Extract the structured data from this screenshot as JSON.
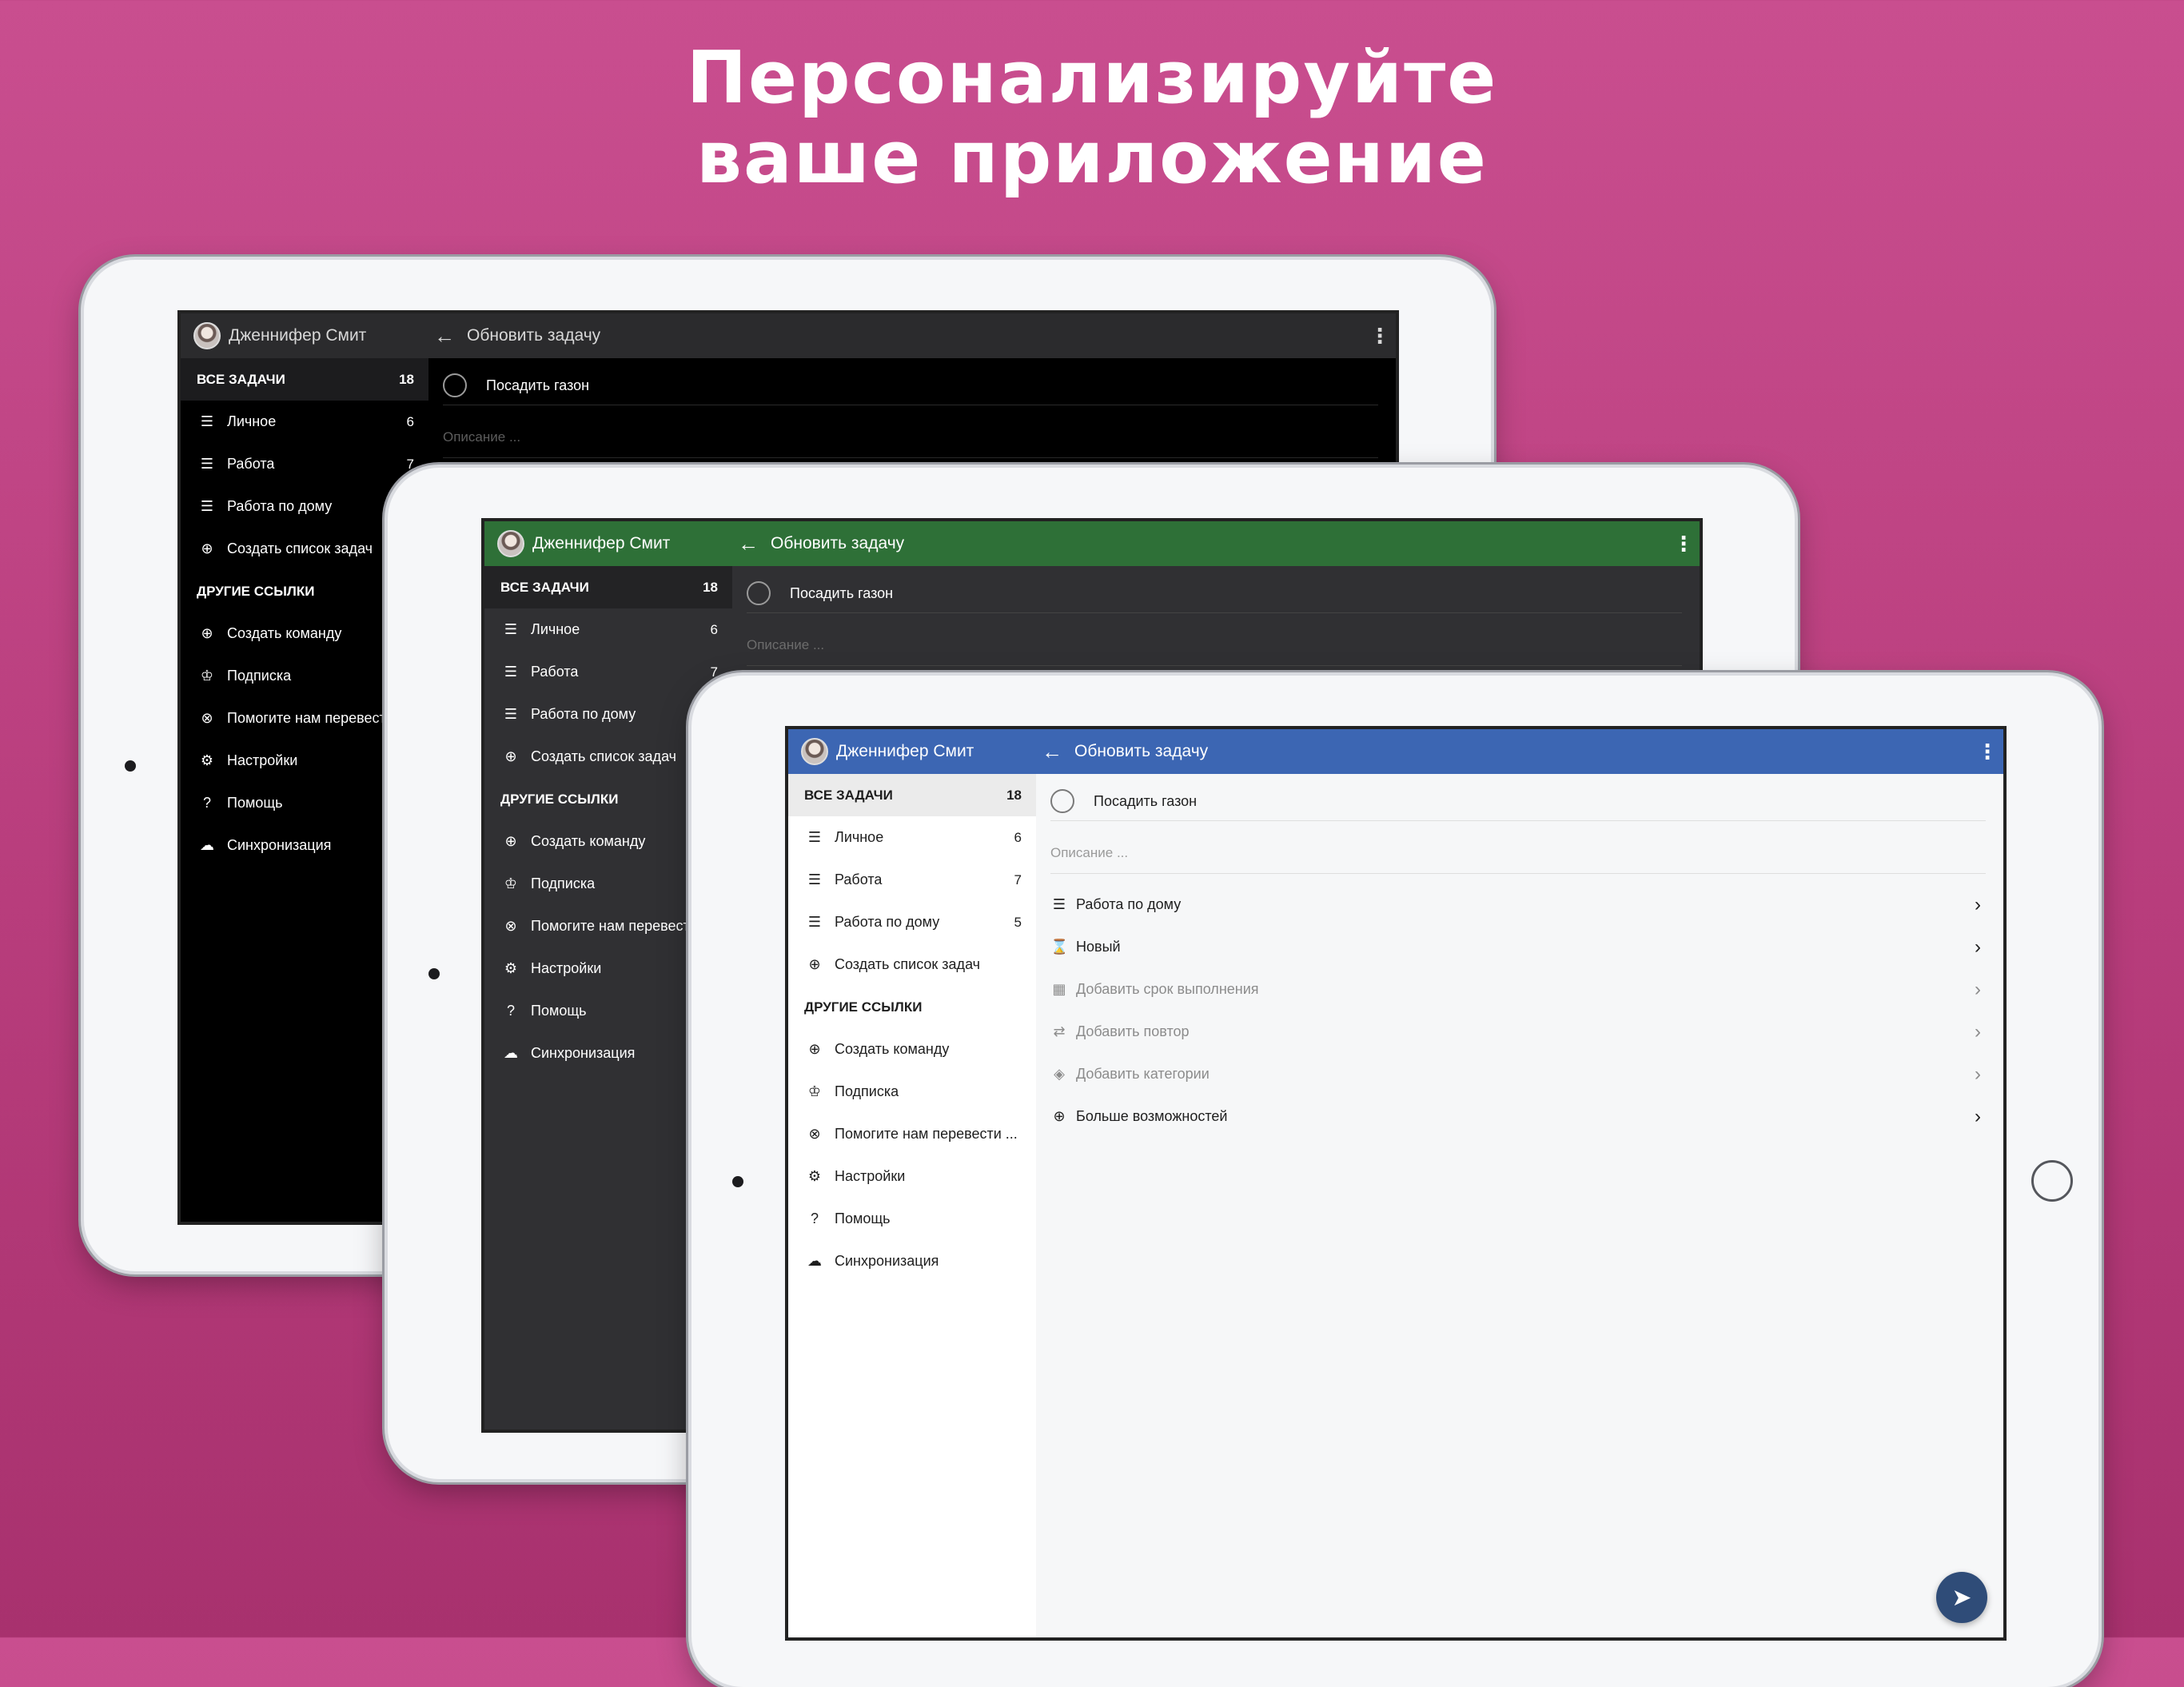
{
  "headline": {
    "line1": "Персонализируйте",
    "line2": "ваше приложение"
  },
  "app": {
    "user_name": "Дженнифер Смит",
    "screen_title": "Обновить задачу",
    "back_glyph": "←",
    "menu_glyph": "⋮",
    "all_tasks": {
      "label": "ВСЕ ЗАДАЧИ",
      "count": "18"
    },
    "lists": [
      {
        "label": "Личное",
        "count": "6",
        "icon": "list-icon"
      },
      {
        "label": "Работа",
        "count": "7",
        "icon": "list-icon"
      },
      {
        "label": "Работа по дому",
        "count": "5",
        "icon": "list-icon"
      }
    ],
    "create_list": "Создать список задач",
    "other_links_header": "ДРУГИЕ ССЫЛКИ",
    "other_links": [
      {
        "label": "Создать команду",
        "icon": "plus-circle-icon"
      },
      {
        "label": "Подписка",
        "icon": "crown-icon"
      },
      {
        "label": "Помогите нам перевести ...",
        "icon": "globe-icon"
      },
      {
        "label": "Настройки",
        "icon": "gear-icon"
      },
      {
        "label": "Помощь",
        "icon": "help-icon"
      },
      {
        "label": "Синхронизация",
        "icon": "cloud-upload-icon"
      }
    ],
    "task_title": "Посадить газон",
    "description_placeholder": "Описание ...",
    "options": [
      {
        "label": "Работа по дому",
        "icon": "list-icon",
        "muted": false
      },
      {
        "label": "Новый",
        "icon": "hourglass-icon",
        "muted": false
      },
      {
        "label": "Добавить срок выполнения",
        "icon": "calendar-icon",
        "muted": true
      },
      {
        "label": "Добавить повтор",
        "icon": "repeat-icon",
        "muted": true
      },
      {
        "label": "Добавить категории",
        "icon": "tag-icon",
        "muted": true
      },
      {
        "label": "Больше возможностей",
        "icon": "plus-circle-icon",
        "muted": false
      }
    ],
    "chevron_glyph": "›",
    "send_glyph": "➤"
  },
  "themes": {
    "black_bar": "#2b2b2d",
    "green_bar": "#2e7037",
    "blue_bar": "#3c66b3"
  }
}
